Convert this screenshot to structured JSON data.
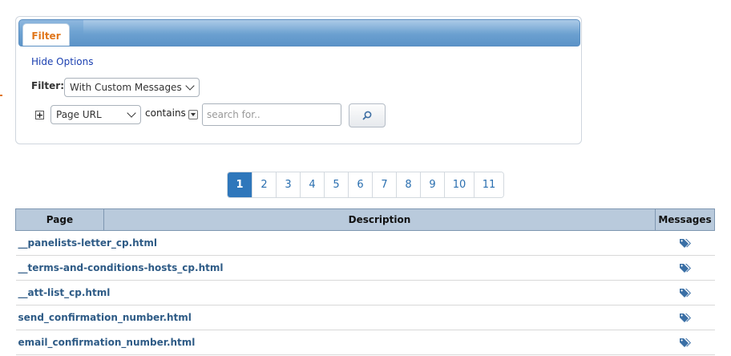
{
  "filter_panel": {
    "tab_label": "Filter",
    "hide_options_label": "Hide Options",
    "filter_label": "Filter:",
    "filter_select_value": "With Custom Messages",
    "field_select_value": "Page URL",
    "operator_label": "contains",
    "search_placeholder": "search for.."
  },
  "pagination": {
    "pages": [
      "1",
      "2",
      "3",
      "4",
      "5",
      "6",
      "7",
      "8",
      "9",
      "10",
      "11"
    ],
    "active": "1"
  },
  "table": {
    "columns": [
      "Page",
      "Description",
      "Messages"
    ],
    "rows": [
      {
        "page": "__panelists-letter_cp.html",
        "description": ""
      },
      {
        "page": "__terms-and-conditions-hosts_cp.html",
        "description": ""
      },
      {
        "page": "__att-list_cp.html",
        "description": ""
      },
      {
        "page": "send_confirmation_number.html",
        "description": ""
      },
      {
        "page": "email_confirmation_number.html",
        "description": ""
      }
    ]
  },
  "icons": {
    "search": "magnifier-icon",
    "messages": "tags-icon",
    "add": "plus-icon"
  },
  "colors": {
    "accent": "#e0761b",
    "header_blue": "#6fa3d2",
    "active_page": "#2f77bb",
    "link": "#2e5b86",
    "table_header": "#b9cadc"
  }
}
